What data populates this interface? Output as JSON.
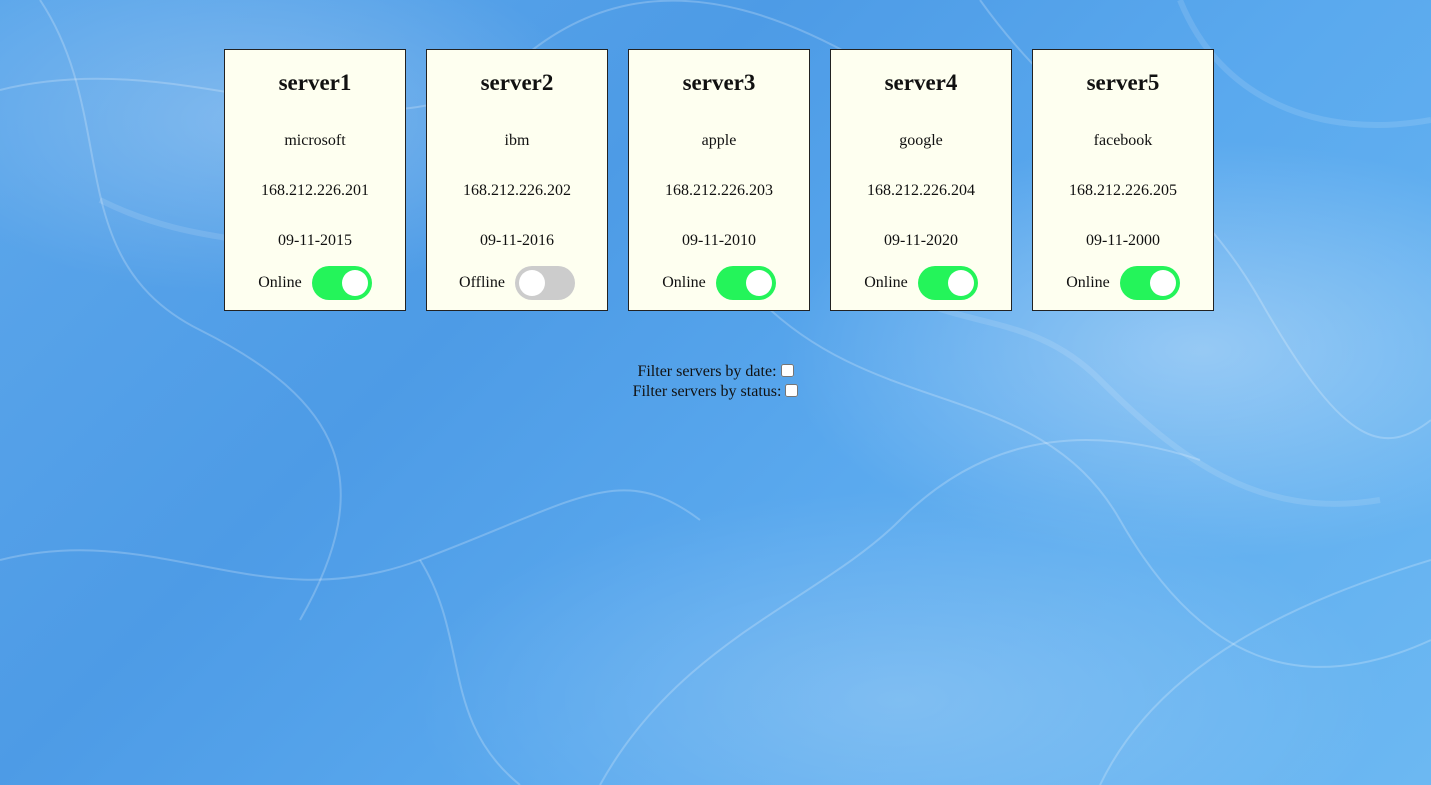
{
  "colors": {
    "card_background": "#fefff0",
    "toggle_on": "#24f45a",
    "toggle_off": "#cccccc",
    "page_background": "#5ea8eb"
  },
  "servers": [
    {
      "name": "server1",
      "company": "microsoft",
      "ip": "168.212.226.201",
      "date": "09-11-2015",
      "status": "Online",
      "online": true
    },
    {
      "name": "server2",
      "company": "ibm",
      "ip": "168.212.226.202",
      "date": "09-11-2016",
      "status": "Offline",
      "online": false
    },
    {
      "name": "server3",
      "company": "apple",
      "ip": "168.212.226.203",
      "date": "09-11-2010",
      "status": "Online",
      "online": true
    },
    {
      "name": "server4",
      "company": "google",
      "ip": "168.212.226.204",
      "date": "09-11-2020",
      "status": "Online",
      "online": true
    },
    {
      "name": "server5",
      "company": "facebook",
      "ip": "168.212.226.205",
      "date": "09-11-2000",
      "status": "Online",
      "online": true
    }
  ],
  "filters": {
    "by_date_label": "Filter servers by date:",
    "by_date_checked": false,
    "by_status_label": "Filter servers by status:",
    "by_status_checked": false
  }
}
